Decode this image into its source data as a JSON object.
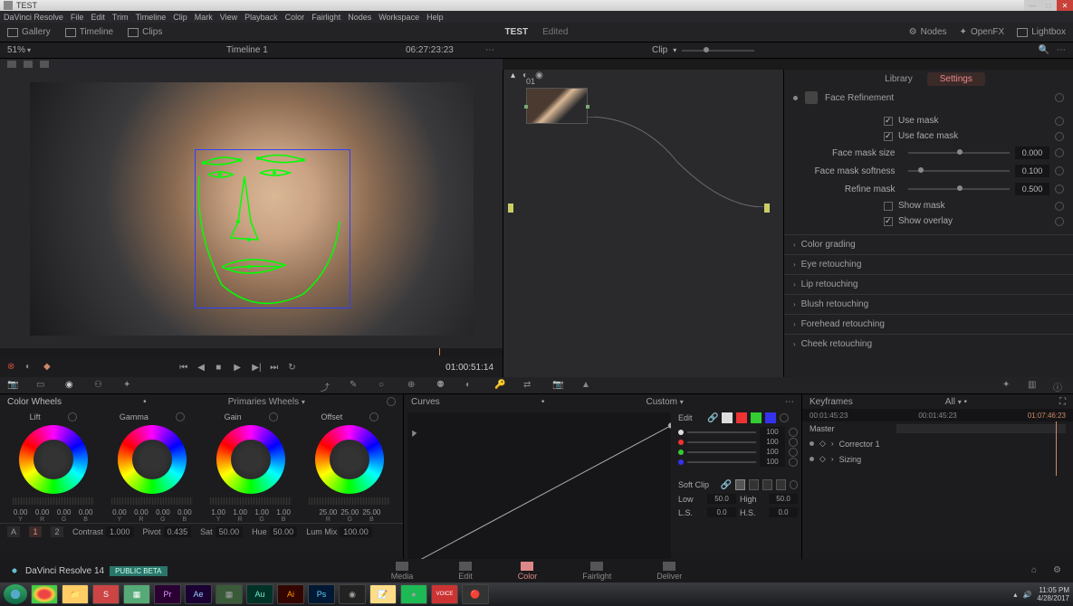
{
  "window": {
    "title": "TEST"
  },
  "menu": [
    "DaVinci Resolve",
    "File",
    "Edit",
    "Trim",
    "Timeline",
    "Clip",
    "Mark",
    "View",
    "Playback",
    "Color",
    "Fairlight",
    "Nodes",
    "Workspace",
    "Help"
  ],
  "top_toolbar": {
    "gallery": "Gallery",
    "timeline": "Timeline",
    "clips": "Clips",
    "project": "TEST",
    "status": "Edited",
    "nodes": "Nodes",
    "openfx": "OpenFX",
    "lightbox": "Lightbox"
  },
  "sec_bar": {
    "zoom": "51%",
    "timeline": "Timeline 1",
    "tc1": "06:27:23:23",
    "clip": "Clip"
  },
  "viewer": {
    "tc": "01:00:51:14"
  },
  "node": {
    "label": "01"
  },
  "inspector": {
    "tabs": {
      "library": "Library",
      "settings": "Settings"
    },
    "face_refinement": "Face Refinement",
    "use_mask": "Use mask",
    "use_face_mask": "Use face mask",
    "face_mask_size": {
      "label": "Face mask size",
      "value": "0.000"
    },
    "face_mask_softness": {
      "label": "Face mask softness",
      "value": "0.100"
    },
    "refine_mask": {
      "label": "Refine mask",
      "value": "0.500"
    },
    "show_mask": "Show mask",
    "show_overlay": "Show overlay",
    "sections": [
      "Color grading",
      "Eye retouching",
      "Lip retouching",
      "Blush retouching",
      "Forehead retouching",
      "Cheek retouching"
    ]
  },
  "wheels": {
    "title": "Color Wheels",
    "mode": "Primaries Wheels",
    "units": [
      {
        "name": "Lift",
        "vals": [
          "0.00",
          "0.00",
          "0.00",
          "0.00"
        ]
      },
      {
        "name": "Gamma",
        "vals": [
          "0.00",
          "0.00",
          "0.00",
          "0.00"
        ]
      },
      {
        "name": "Gain",
        "vals": [
          "1.00",
          "1.00",
          "1.00",
          "1.00"
        ]
      },
      {
        "name": "Offset",
        "vals": [
          "25.00",
          "25.00",
          "25.00"
        ]
      }
    ],
    "channels4": [
      "Y",
      "R",
      "G",
      "B"
    ],
    "channels3": [
      "R",
      "G",
      "B"
    ],
    "footer": {
      "page_a": "A",
      "page_1": "1",
      "page_2": "2",
      "contrast": {
        "label": "Contrast",
        "value": "1.000"
      },
      "pivot": {
        "label": "Pivot",
        "value": "0.435"
      },
      "sat": {
        "label": "Sat",
        "value": "50.00"
      },
      "hue": {
        "label": "Hue",
        "value": "50.00"
      },
      "lummix": {
        "label": "Lum Mix",
        "value": "100.00"
      }
    }
  },
  "curves": {
    "title": "Curves",
    "mode": "Custom",
    "edit": "Edit",
    "channels": [
      {
        "color": "#ddd",
        "value": "100"
      },
      {
        "color": "#e33",
        "value": "100"
      },
      {
        "color": "#3c3",
        "value": "100"
      },
      {
        "color": "#33e",
        "value": "100"
      }
    ],
    "softclip": "Soft Clip",
    "low": {
      "label": "Low",
      "value": "50.0"
    },
    "high": {
      "label": "High",
      "value": "50.0"
    },
    "ls": {
      "label": "L.S.",
      "value": "0.0"
    },
    "hs": {
      "label": "H.S.",
      "value": "0.0"
    }
  },
  "keyframes": {
    "title": "Keyframes",
    "all": "All",
    "tc_left": "00:01:45:23",
    "tc_right": "00:01:45:23",
    "tc_far": "01:07:46:23",
    "master": "Master",
    "corrector": "Corrector 1",
    "sizing": "Sizing"
  },
  "pages": {
    "app": "DaVinci Resolve 14",
    "badge": "PUBLIC BETA",
    "tabs": [
      "Media",
      "Edit",
      "Color",
      "Fairlight",
      "Deliver"
    ]
  },
  "taskbar": {
    "time": "11:05 PM",
    "date": "4/28/2017"
  }
}
